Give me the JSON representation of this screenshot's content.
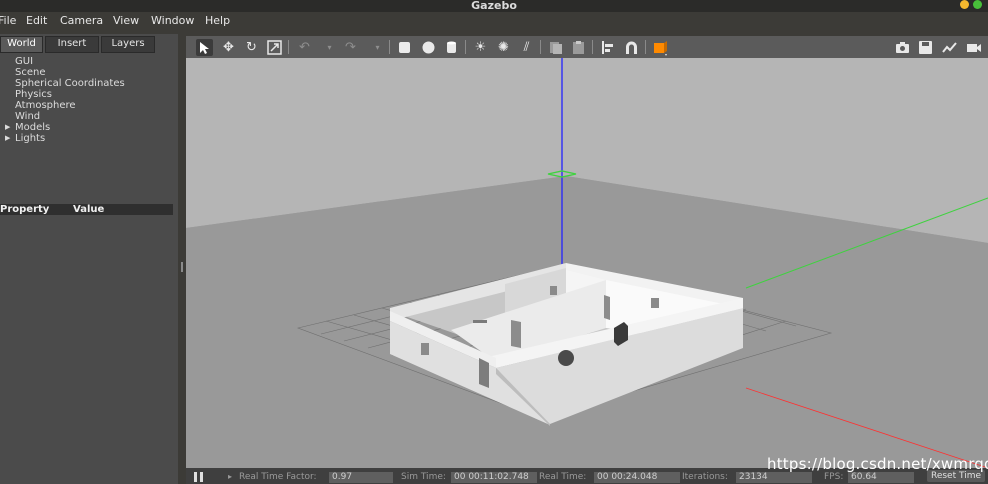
{
  "window": {
    "title": "Gazebo"
  },
  "menu": [
    "File",
    "Edit",
    "Camera",
    "View",
    "Window",
    "Help"
  ],
  "left_panel": {
    "tabs": [
      "World",
      "Insert",
      "Layers"
    ],
    "tree": [
      "GUI",
      "Scene",
      "Spherical Coordinates",
      "Physics",
      "Atmosphere",
      "Wind",
      "Models",
      "Lights"
    ],
    "property_header": {
      "property": "Property",
      "value": "Value"
    }
  },
  "toolbar": {
    "tools": [
      "select-mode",
      "translate-mode",
      "rotate-mode",
      "scale-mode",
      "undo",
      "undo-history",
      "redo",
      "redo-history",
      "box",
      "sphere",
      "cylinder",
      "point-light",
      "spot-light",
      "directional-light",
      "copy",
      "paste",
      "align",
      "snap",
      "change-view"
    ],
    "right_tools": [
      "screenshot",
      "record-log",
      "plot",
      "video-record"
    ]
  },
  "status": {
    "real_time_factor_label": "Real Time Factor:",
    "real_time_factor": "0.97",
    "sim_time_label": "Sim Time:",
    "sim_time": "00 00:11:02.748",
    "real_time_label": "Real Time:",
    "real_time": "00 00:24.048",
    "iterations_label": "Iterations:",
    "iterations": "23134",
    "fps_label": "FPS:",
    "fps": "60.64",
    "reset_label": "Reset Time"
  },
  "watermark": "https://blog.csdn.net/xwmrqqq",
  "colors": {
    "z_axis": "#2424ff",
    "y_axis": "#3fd23f",
    "x_axis": "#ff3030",
    "active_tool": "#ff8a00"
  }
}
